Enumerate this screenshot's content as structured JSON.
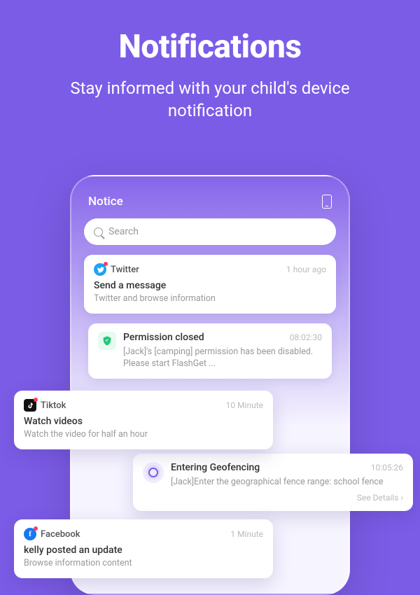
{
  "hero": {
    "title": "Notifications",
    "subtitle": "Stay informed with your child's device notification"
  },
  "phone": {
    "header": "Notice",
    "search_placeholder": "Search"
  },
  "cards": {
    "twitter": {
      "app": "Twitter",
      "time": "1 hour ago",
      "title": "Send a message",
      "desc": "Twitter and browse information"
    },
    "permission": {
      "title": "Permission closed",
      "time": "08:02:30",
      "desc": "[Jack]'s [camping] permission has been disabled. Please start FlashGet   ..."
    },
    "tiktok": {
      "app": "Tiktok",
      "time": "10 Minute",
      "title": "Watch videos",
      "desc": "Watch the video for half an hour"
    },
    "geo": {
      "title": "Entering Geofencing",
      "time": "10:05:26",
      "desc": "[Jack]Enter the geographical fence range: school fence",
      "see": "See Details"
    },
    "facebook": {
      "app": "Facebook",
      "time": "1 Minute",
      "title": "kelly posted an update",
      "desc": "Browse information content"
    }
  }
}
